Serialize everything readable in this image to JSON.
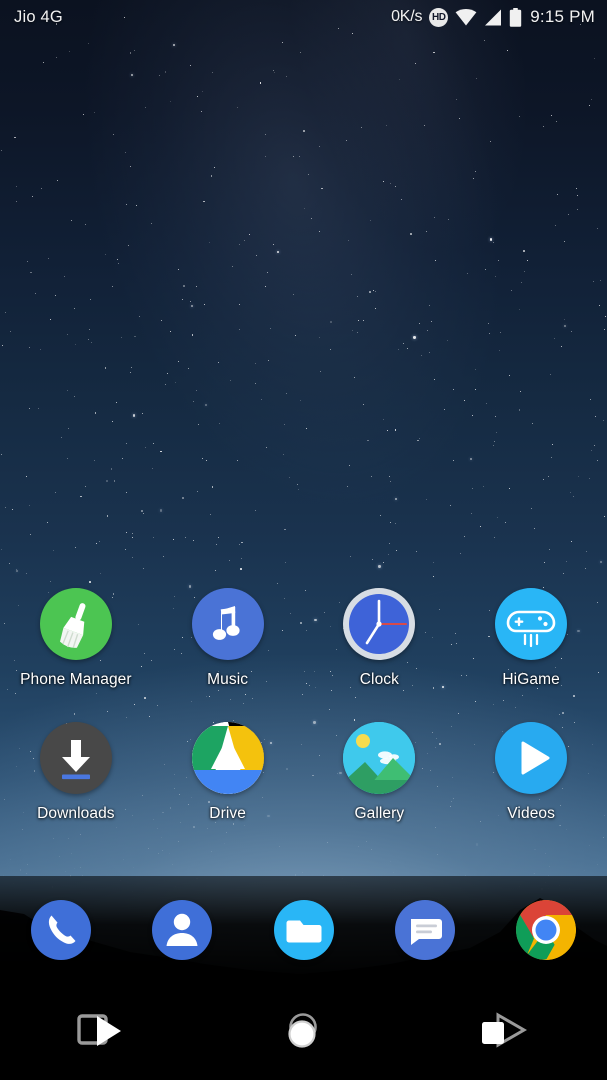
{
  "status_bar": {
    "carrier": "Jio 4G",
    "network_speed": "0K/s",
    "hd_badge": "HD",
    "wifi_icon": "wifi-icon",
    "signal_icon": "signal-bars-icon",
    "battery_icon": "battery-icon",
    "time": "9:15 PM"
  },
  "home_screen": {
    "rows": [
      {
        "apps": [
          {
            "label": "Phone Manager",
            "icon": "broom-icon",
            "color": "#4CC552"
          },
          {
            "label": "Music",
            "icon": "music-note-icon",
            "color": "#4A73D6"
          },
          {
            "label": "Clock",
            "icon": "analog-clock-icon",
            "color": "#3E63D8"
          },
          {
            "label": "HiGame",
            "icon": "gamepad-icon",
            "color": "#29B6F6"
          }
        ]
      },
      {
        "apps": [
          {
            "label": "Downloads",
            "icon": "download-arrow-icon",
            "color": "#484848"
          },
          {
            "label": "Drive",
            "icon": "drive-triangle-icon",
            "color": "#FFFFFF"
          },
          {
            "label": "Gallery",
            "icon": "photo-landscape-icon",
            "color": "#3CC8E8"
          },
          {
            "label": "Videos",
            "icon": "play-button-icon",
            "color": "#28AAF0"
          }
        ]
      }
    ]
  },
  "dock": {
    "items": [
      {
        "label": "Phone",
        "icon": "phone-handset-icon",
        "color": "#3F6FD8"
      },
      {
        "label": "Contacts",
        "icon": "person-icon",
        "color": "#3F6FD8"
      },
      {
        "label": "Files",
        "icon": "folder-icon",
        "color": "#29B6F6"
      },
      {
        "label": "Messages",
        "icon": "message-bubble-icon",
        "color": "#4A73D6"
      },
      {
        "label": "Chrome",
        "icon": "chrome-icon",
        "color": "#4285F4"
      }
    ]
  },
  "nav_bar": {
    "buttons": [
      {
        "label": "Recents",
        "icon": "recents-square-icon"
      },
      {
        "label": "Home",
        "icon": "home-circle-icon"
      },
      {
        "label": "Back",
        "icon": "back-triangle-icon"
      }
    ]
  },
  "colors": {
    "accent_blue": "#4285F4",
    "sky_top": "#0b1220",
    "sky_horizon": "#8fa9be",
    "nav_background": "#000000",
    "label_text": "#ffffff"
  }
}
